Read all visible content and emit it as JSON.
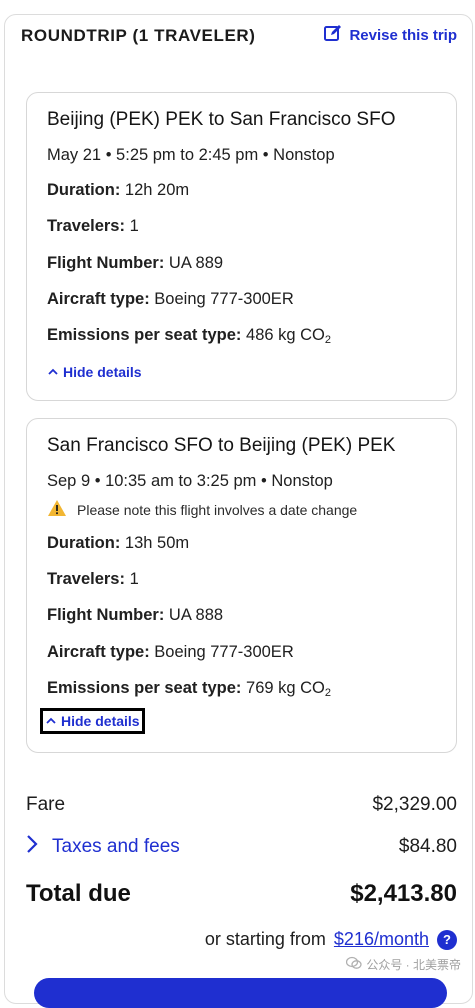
{
  "header": {
    "title": "ROUNDTRIP (1 TRAVELER)",
    "revise_label": "Revise this trip"
  },
  "flights": [
    {
      "route": "Beijing (PEK) PEK to San Francisco SFO",
      "schedule": "May 21 • 5:25 pm to 2:45 pm • Nonstop",
      "duration_label": "Duration:",
      "duration": "12h 20m",
      "travelers_label": "Travelers:",
      "travelers": "1",
      "flight_number_label": "Flight Number:",
      "flight_number": "UA 889",
      "aircraft_label": "Aircraft type:",
      "aircraft": "Boeing 777-300ER",
      "emissions_label": "Emissions per seat type:",
      "emissions": "486 kg CO",
      "emissions_sub": "2",
      "hide_details": "Hide details"
    },
    {
      "route": "San Francisco SFO to Beijing (PEK) PEK",
      "schedule": "Sep 9 • 10:35 am to 3:25 pm • Nonstop",
      "warning": "Please note this flight involves a date change",
      "duration_label": "Duration:",
      "duration": "13h 50m",
      "travelers_label": "Travelers:",
      "travelers": "1",
      "flight_number_label": "Flight Number:",
      "flight_number": "UA 888",
      "aircraft_label": "Aircraft type:",
      "aircraft": "Boeing 777-300ER",
      "emissions_label": "Emissions per seat type:",
      "emissions": "769 kg CO",
      "emissions_sub": "2",
      "hide_details": "Hide details"
    }
  ],
  "pricing": {
    "fare_label": "Fare",
    "fare_value": "$2,329.00",
    "taxes_label": "Taxes and fees",
    "taxes_value": "$84.80",
    "total_label": "Total due",
    "total_value": "$2,413.80",
    "financing_prefix": "or starting from",
    "financing_link": "$216/month",
    "help_glyph": "?"
  },
  "watermark": "公众号 · 北美票帝",
  "colors": {
    "accent": "#1f2fd0",
    "warning": "#f2b632",
    "border": "#d7d7d7"
  }
}
